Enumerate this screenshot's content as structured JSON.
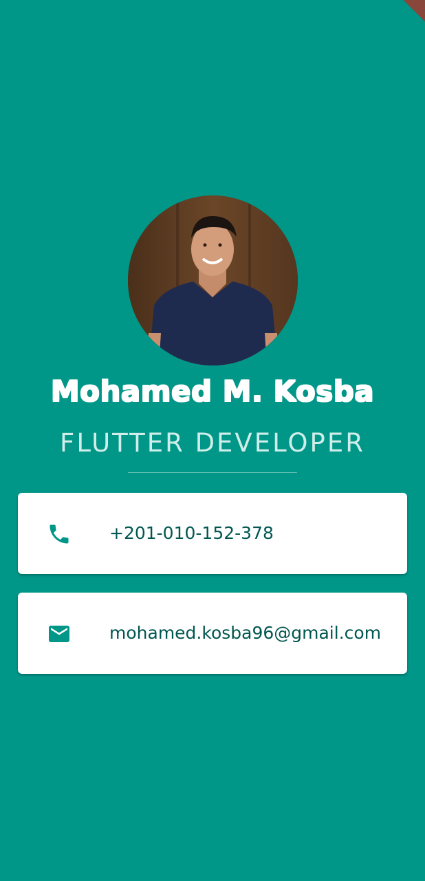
{
  "profile": {
    "name": "Mohamed M. Kosba",
    "title": "FLUTTER DEVELOPER"
  },
  "contacts": {
    "phone": {
      "icon": "phone-icon",
      "value": "+201-010-152-378"
    },
    "email": {
      "icon": "mail-icon",
      "value": "mohamed.kosba96@gmail.com"
    }
  },
  "colors": {
    "background": "#009688",
    "card": "#ffffff",
    "accent_text": "#00574f",
    "icon": "#009688"
  }
}
